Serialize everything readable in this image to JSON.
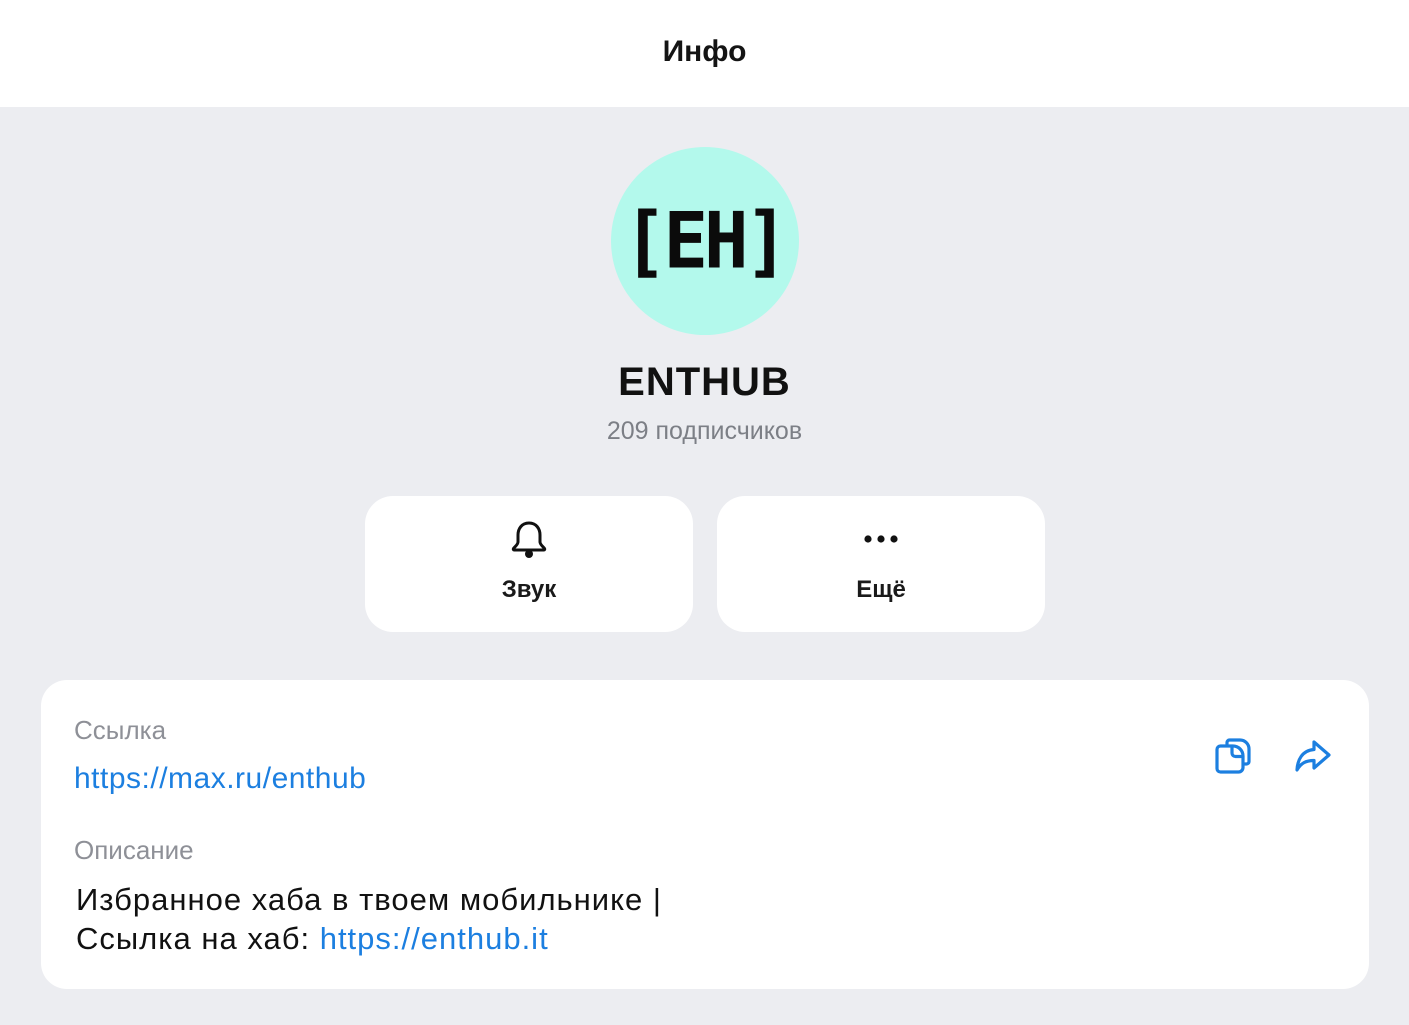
{
  "header": {
    "title": "Инфо"
  },
  "channel": {
    "avatar_text": "[EH]",
    "avatar_color": "#b3f9ec",
    "name": "ENTHUB",
    "subscribers": "209 подписчиков"
  },
  "actions": [
    {
      "label": "Звук",
      "icon": "bell-icon"
    },
    {
      "label": "Ещё",
      "icon": "more-dots-icon"
    }
  ],
  "info": {
    "link_label": "Ссылка",
    "link_value": "https://max.ru/enthub",
    "description_label": "Описание",
    "description_line1": "Избранное хаба в твоем мобильнике |",
    "description_line2_prefix": "Ссылка на хаб: ",
    "description_line2_link": "https://enthub.it",
    "copy_icon": "copy-icon",
    "share_icon": "share-icon"
  },
  "colors": {
    "background": "#ecedf1",
    "accent_link": "#1c7fe0",
    "secondary_text": "#8e9097"
  }
}
